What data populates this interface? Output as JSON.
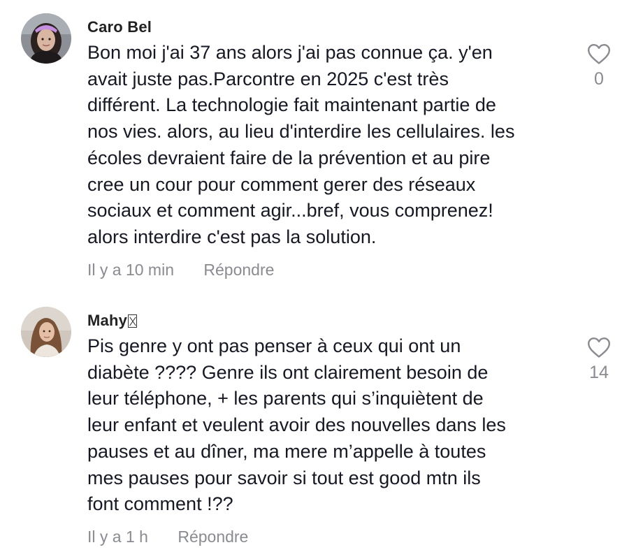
{
  "comments": [
    {
      "author": "Caro Bel",
      "text": "Bon moi j'ai 37 ans alors j'ai pas connue ça. y'en\navait juste pas.Parcontre en 2025 c'est très\ndifférent. La technologie fait maintenant partie de\nnos vies. alors, au lieu d'interdire les cellulaires. les\nécoles devraient faire de la prévention et au pire\ncree un cour pour comment gerer des réseaux\nsociaux et comment agir...bref, vous comprenez!\nalors interdire c'est pas la solution.",
      "time": "Il y a 10 min",
      "reply_label": "Répondre",
      "likes": "0",
      "avatar_icon": "avatar-woman-purple-headband"
    },
    {
      "author": "Mahy",
      "text": "Pis genre y ont pas penser à ceux qui ont un\ndiabète ???? Genre ils ont clairement besoin de\nleur téléphone, + les parents qui s’inquiètent de\nleur enfant et veulent avoir des nouvelles dans les\npauses et au dîner, ma mere m’appelle à toutes\nmes pauses pour savoir si tout est good mtn ils\nfont comment !??",
      "time": "Il y a 1 h",
      "reply_label": "Répondre",
      "likes": "14",
      "avatar_icon": "avatar-girl-brown-hair"
    }
  ],
  "colors": {
    "text": "#161823",
    "muted": "#8a8b91",
    "background": "#ffffff"
  },
  "icons": {
    "like": "heart-outline-icon",
    "badge": "missing-glyph-box"
  }
}
